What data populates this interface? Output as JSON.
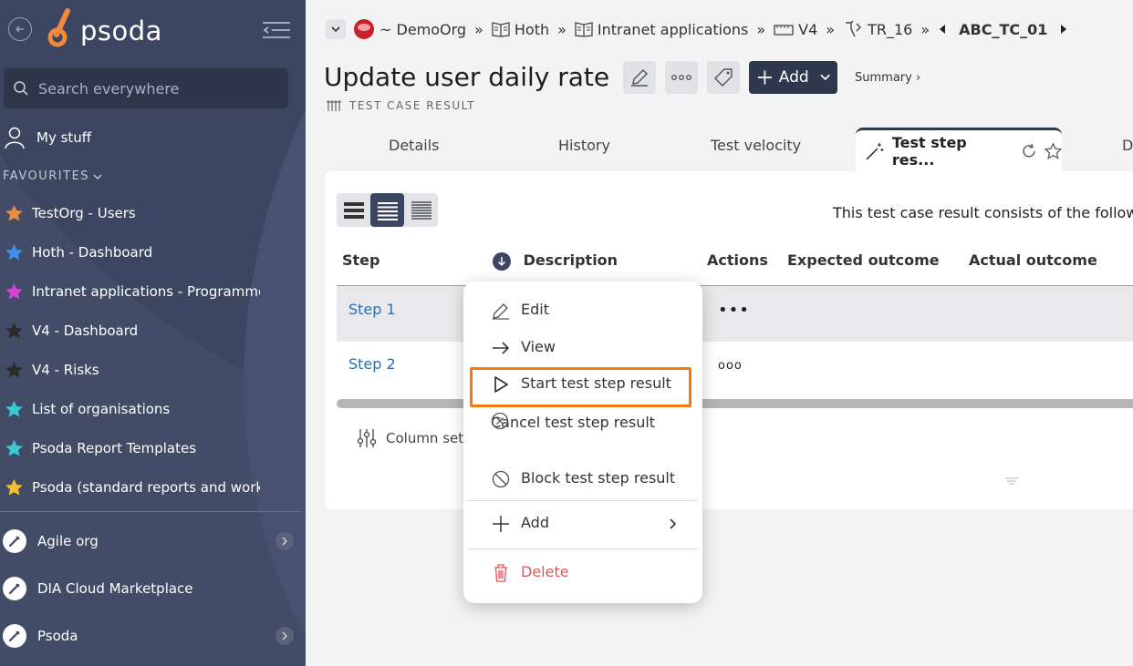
{
  "sidebar": {
    "logo_text": "psoda",
    "search_placeholder": "Search everywhere",
    "my_stuff": "My stuff",
    "favourites_heading": "FAVOURITES",
    "favourites": [
      {
        "label": "TestOrg - Users",
        "star_color": "#f08a3c"
      },
      {
        "label": "Hoth - Dashboard",
        "star_color": "#3f8ee8"
      },
      {
        "label": "Intranet applications - Programme...",
        "star_color": "#d83fd8"
      },
      {
        "label": "V4 - Dashboard",
        "star_color": "#2b2b2b"
      },
      {
        "label": "V4 - Risks",
        "star_color": "#2b2b2b"
      },
      {
        "label": "List of organisations",
        "star_color": "#3cc8d8"
      },
      {
        "label": "Psoda Report Templates",
        "star_color": "#3cc8d8"
      },
      {
        "label": "Psoda (standard reports and work...",
        "star_color": "#f0c030"
      }
    ],
    "organisations": [
      {
        "label": "Agile org",
        "has_arrow": true
      },
      {
        "label": "DIA Cloud Marketplace",
        "has_arrow": false
      },
      {
        "label": "Psoda",
        "has_arrow": true
      }
    ]
  },
  "breadcrumb": {
    "org": "~ DemoOrg",
    "items": [
      "Hoth",
      "Intranet applications",
      "V4",
      "TR_16"
    ],
    "separator": "»",
    "current": "ABC_TC_01"
  },
  "header": {
    "title": "Update user daily rate",
    "add_label": "Add",
    "summary_label": "Summary ›",
    "subtitle": "TEST CASE RESULT"
  },
  "tabs": {
    "details": "Details",
    "history": "History",
    "velocity": "Test velocity",
    "active": "Test step res...",
    "next_partial": "D"
  },
  "content": {
    "intro": "This test case result consists of the followin",
    "columns": {
      "step": "Step",
      "description": "Description",
      "actions": "Actions",
      "expected": "Expected outcome",
      "actual": "Actual outcome"
    },
    "rows": [
      {
        "step": "Step 1",
        "actions": "•••"
      },
      {
        "step": "Step 2",
        "actions": "ooo"
      }
    ],
    "column_settings": "Column setti"
  },
  "context_menu": {
    "edit": "Edit",
    "view": "View",
    "start": "Start test step result",
    "cancel": "Cancel test step result",
    "block": "Block test step result",
    "add": "Add",
    "delete": "Delete"
  },
  "colors": {
    "sidebar_bg": "#3d4660",
    "accent_dark": "#2f374d",
    "highlight": "#f07b14",
    "link": "#2f6ea8",
    "delete": "#e0555a",
    "logo_orange": "#f08a3c"
  }
}
